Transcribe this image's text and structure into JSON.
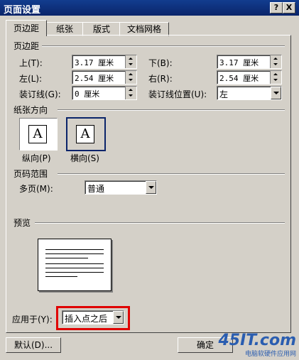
{
  "window": {
    "title": "页面设置",
    "help_label": "?",
    "close_label": "X"
  },
  "tabs": [
    {
      "label": "页边距",
      "active": true
    },
    {
      "label": "纸张"
    },
    {
      "label": "版式"
    },
    {
      "label": "文档网格"
    }
  ],
  "margins": {
    "group_label": "页边距",
    "top": {
      "label": "上(T):",
      "value": "3.17 厘米"
    },
    "bottom": {
      "label": "下(B):",
      "value": "3.17 厘米"
    },
    "left": {
      "label": "左(L):",
      "value": "2.54 厘米"
    },
    "right": {
      "label": "右(R):",
      "value": "2.54 厘米"
    },
    "gutter": {
      "label": "装订线(G):",
      "value": "0 厘米"
    },
    "gutter_pos": {
      "label": "装订线位置(U):",
      "value": "左"
    }
  },
  "orientation": {
    "group_label": "纸张方向",
    "glyph": "A",
    "portrait_label": "纵向(P)",
    "landscape_label": "横向(S)",
    "selected": "landscape"
  },
  "pages": {
    "group_label": "页码范围",
    "multiple_label": "多页(M):",
    "multiple_value": "普通"
  },
  "preview": {
    "group_label": "预览",
    "apply_label": "应用于(Y):",
    "apply_value": "插入点之后"
  },
  "buttons": {
    "default_label": "默认(D)...",
    "ok_label": "确定"
  },
  "watermark": {
    "brand": "45IT.com",
    "subtitle": "电脑软硬件应用网"
  },
  "colors": {
    "highlight": "#e00000",
    "title_bar": "#0a246a",
    "brand": "#2a5db0"
  }
}
